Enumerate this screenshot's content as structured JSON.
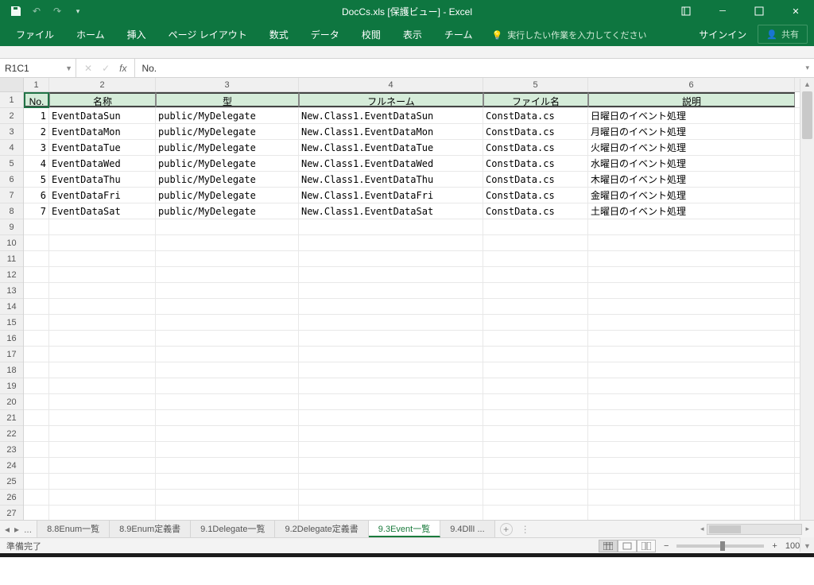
{
  "title_bar": {
    "app_title": "DocCs.xls  [保護ビュー] - Excel"
  },
  "ribbon": {
    "tabs": [
      "ファイル",
      "ホーム",
      "挿入",
      "ページ レイアウト",
      "数式",
      "データ",
      "校閲",
      "表示",
      "チーム"
    ],
    "tell_me": "実行したい作業を入力してください",
    "sign_in": "サインイン",
    "share": "共有"
  },
  "name_box": "R1C1",
  "formula_bar": "No.",
  "columns": [
    "1",
    "2",
    "3",
    "4",
    "5",
    "6"
  ],
  "headers": [
    "No.",
    "名称",
    "型",
    "フルネーム",
    "ファイル名",
    "説明"
  ],
  "rows": [
    {
      "no": "1",
      "name": "EventDataSun",
      "type": "public/MyDelegate",
      "full": "New.Class1.EventDataSun",
      "file": "ConstData.cs",
      "desc": "日曜日のイベント処理"
    },
    {
      "no": "2",
      "name": "EventDataMon",
      "type": "public/MyDelegate",
      "full": "New.Class1.EventDataMon",
      "file": "ConstData.cs",
      "desc": "月曜日のイベント処理"
    },
    {
      "no": "3",
      "name": "EventDataTue",
      "type": "public/MyDelegate",
      "full": "New.Class1.EventDataTue",
      "file": "ConstData.cs",
      "desc": "火曜日のイベント処理"
    },
    {
      "no": "4",
      "name": "EventDataWed",
      "type": "public/MyDelegate",
      "full": "New.Class1.EventDataWed",
      "file": "ConstData.cs",
      "desc": "水曜日のイベント処理"
    },
    {
      "no": "5",
      "name": "EventDataThu",
      "type": "public/MyDelegate",
      "full": "New.Class1.EventDataThu",
      "file": "ConstData.cs",
      "desc": "木曜日のイベント処理"
    },
    {
      "no": "6",
      "name": "EventDataFri",
      "type": "public/MyDelegate",
      "full": "New.Class1.EventDataFri",
      "file": "ConstData.cs",
      "desc": "金曜日のイベント処理"
    },
    {
      "no": "7",
      "name": "EventDataSat",
      "type": "public/MyDelegate",
      "full": "New.Class1.EventDataSat",
      "file": "ConstData.cs",
      "desc": "土曜日のイベント処理"
    }
  ],
  "empty_row_count": 19,
  "row_numbers": [
    "1",
    "2",
    "3",
    "4",
    "5",
    "6",
    "7",
    "8",
    "9",
    "10",
    "11",
    "12",
    "13",
    "14",
    "15",
    "16",
    "17",
    "18",
    "19",
    "20",
    "21",
    "22",
    "23",
    "24",
    "25",
    "26",
    "27"
  ],
  "sheet_tabs": {
    "ellipsis": "...",
    "tabs": [
      "8.8Enum一覧",
      "8.9Enum定義書",
      "9.1Delegate一覧",
      "9.2Delegate定義書",
      "9.3Event一覧",
      "9.4DllI ..."
    ],
    "active_index": 4
  },
  "status": {
    "ready": "準備完了",
    "zoom": "100%"
  }
}
